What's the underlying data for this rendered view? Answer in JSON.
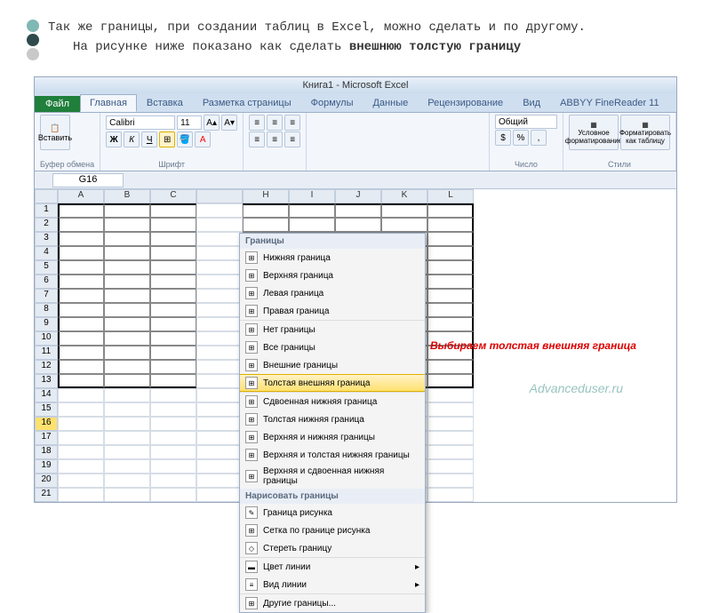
{
  "intro": {
    "line1": "Так же границы, при создании таблиц в Excel, можно сделать и по другому.",
    "line2_a": "На рисунке ниже показано как сделать ",
    "line2_b": "внешнюю толстую границу"
  },
  "window_title": "Книга1 - Microsoft Excel",
  "tabs": {
    "file": "Файл",
    "items": [
      "Главная",
      "Вставка",
      "Разметка страницы",
      "Формулы",
      "Данные",
      "Рецензирование",
      "Вид",
      "ABBYY FineReader 11"
    ],
    "active": 0
  },
  "ribbon": {
    "paste": "Вставить",
    "clipboard_label": "Буфер обмена",
    "font_name": "Calibri",
    "font_size": "11",
    "font_label": "Шрифт",
    "number_format": "Общий",
    "number_label": "Число",
    "cond_format": "Условное форматирование",
    "format_table": "Форматировать как таблицу",
    "styles_label": "Стили"
  },
  "namebox": "G16",
  "columns": [
    "",
    "A",
    "B",
    "C",
    "",
    "H",
    "I",
    "J",
    "K",
    "L"
  ],
  "row_numbers": [
    "1",
    "2",
    "3",
    "4",
    "5",
    "6",
    "7",
    "8",
    "9",
    "10",
    "11",
    "12",
    "13",
    "14",
    "15",
    "16",
    "17",
    "18",
    "19",
    "20",
    "21"
  ],
  "borders_menu": {
    "title": "Границы",
    "items": [
      "Нижняя граница",
      "Верхняя граница",
      "Левая граница",
      "Правая граница",
      "Нет границы",
      "Все границы",
      "Внешние границы",
      "Толстая внешняя граница",
      "Сдвоенная нижняя граница",
      "Толстая нижняя граница",
      "Верхняя и нижняя границы",
      "Верхняя и толстая нижняя границы",
      "Верхняя и сдвоенная нижняя границы"
    ],
    "draw_title": "Нарисовать границы",
    "draw_items": [
      "Граница рисунка",
      "Сетка по границе рисунка",
      "Стереть границу",
      "Цвет линии",
      "Вид линии",
      "Другие границы..."
    ],
    "highlighted_index": 7
  },
  "callout": "Выбираем толстая внешняя граница",
  "watermark": "Advanceduser.ru"
}
